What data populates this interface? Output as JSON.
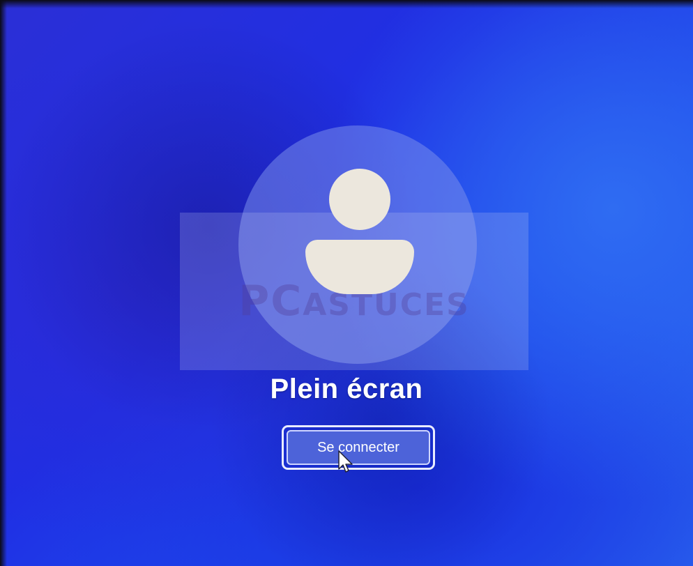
{
  "login_screen": {
    "user_name": "Plein écran",
    "signin_button_label": "Se connecter",
    "watermark_logo": "PC ASTUCES",
    "avatar_icon": "user-avatar-icon",
    "cursor_icon": "mouse-pointer-icon"
  },
  "colors": {
    "background_primary": "#1f2fe4",
    "avatar_fill": "#ece7dd",
    "button_fill": "#4d63d9",
    "text": "#ffffff"
  }
}
